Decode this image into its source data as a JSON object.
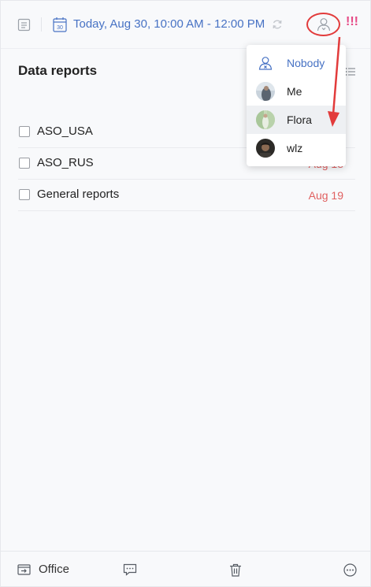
{
  "header": {
    "date_text": "Today, Aug 30, 10:00 AM - 12:00 PM",
    "calendar_day": "30",
    "priority_marks": "!!!",
    "priority_color": "#e64a86",
    "accent_color": "#4772c4"
  },
  "list": {
    "title": "Data reports",
    "tasks": [
      {
        "label": "ASO_USA",
        "due": ""
      },
      {
        "label": "ASO_RUS",
        "due": "Aug 18"
      },
      {
        "label": "General reports",
        "due": "Aug 19"
      }
    ],
    "due_color": "#e06060"
  },
  "assignee_menu": {
    "options": [
      {
        "name": "Nobody",
        "icon": "unassigned-user-icon"
      },
      {
        "name": "Me",
        "icon": "avatar"
      },
      {
        "name": "Flora",
        "icon": "avatar",
        "selected": true
      },
      {
        "name": "wlz",
        "icon": "avatar"
      }
    ]
  },
  "annotation": {
    "color": "#e23b3b"
  },
  "footer": {
    "list_name": "Office",
    "icons": [
      "move-to-list-icon",
      "comment-icon",
      "trash-icon",
      "more-icon"
    ]
  }
}
